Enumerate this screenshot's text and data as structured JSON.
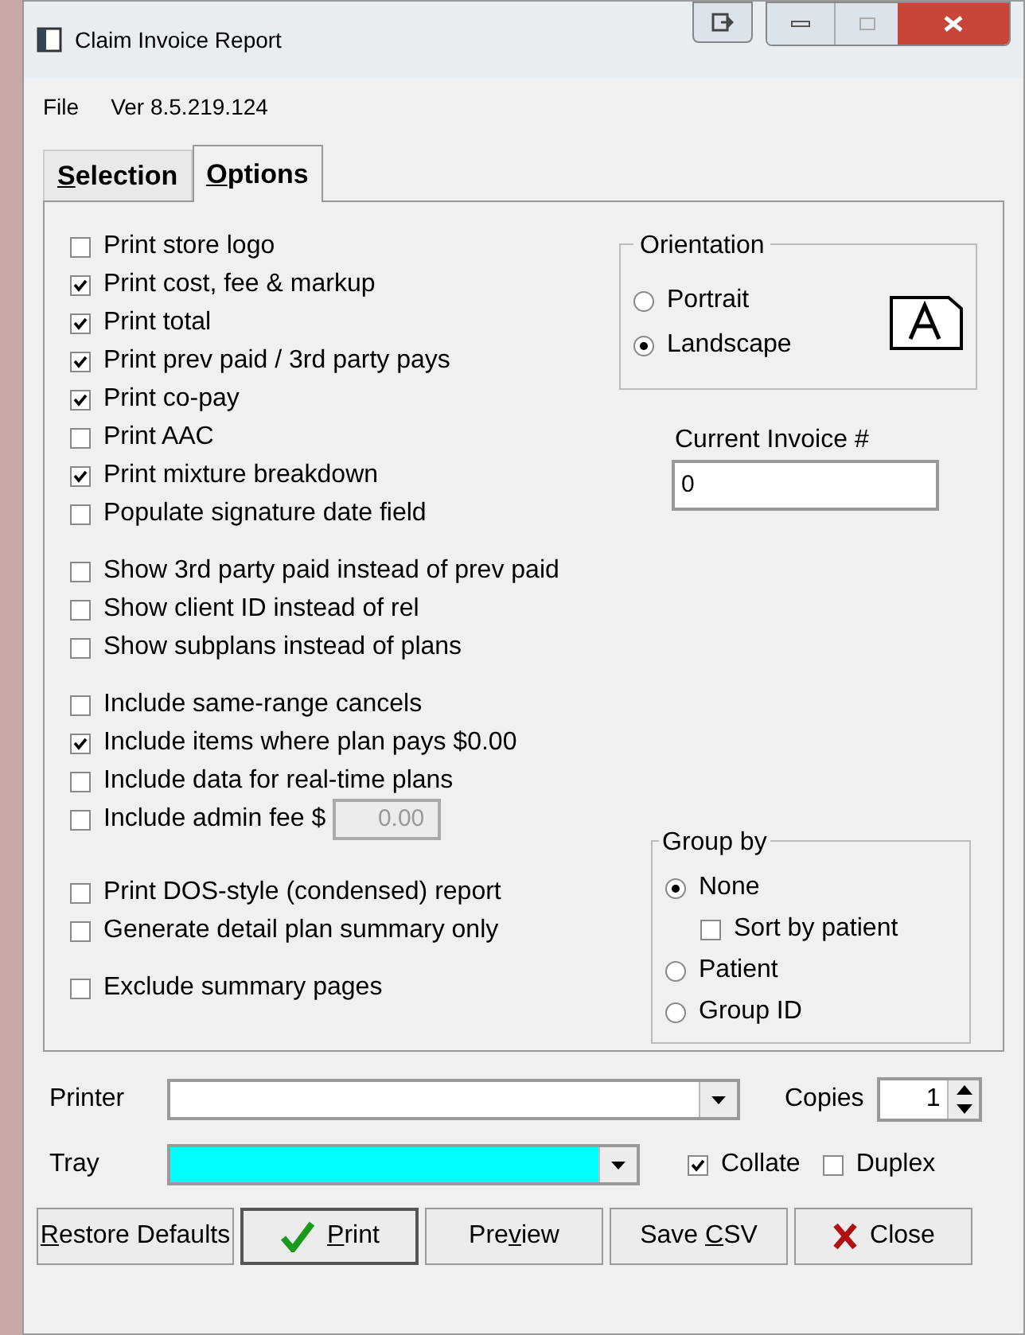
{
  "window": {
    "title": "Claim Invoice Report"
  },
  "menu": [
    {
      "label": "File"
    },
    {
      "label": "Ver 8.5.219.124"
    }
  ],
  "tabs": [
    {
      "key": "S",
      "post": "election",
      "selected": false
    },
    {
      "key": "O",
      "post": "ptions",
      "selected": true
    }
  ],
  "option_groups": [
    [
      {
        "kind": "checkbox",
        "label": "Print store logo",
        "checked": false
      },
      {
        "kind": "checkbox",
        "label": "Print cost, fee & markup",
        "checked": true
      },
      {
        "kind": "checkbox",
        "label": "Print total",
        "checked": true
      },
      {
        "kind": "checkbox",
        "label": "Print prev paid / 3rd party pays",
        "checked": true
      },
      {
        "kind": "checkbox",
        "label": "Print co-pay",
        "checked": true
      },
      {
        "kind": "checkbox",
        "label": "Print AAC",
        "checked": false
      },
      {
        "kind": "checkbox",
        "label": "Print mixture breakdown",
        "checked": true
      },
      {
        "kind": "checkbox",
        "label": "Populate signature date field",
        "checked": false
      }
    ],
    [
      {
        "kind": "checkbox",
        "label": "Show 3rd party paid instead of prev paid",
        "checked": false
      },
      {
        "kind": "checkbox",
        "label": "Show client ID instead of rel",
        "checked": false
      },
      {
        "kind": "checkbox",
        "label": "Show subplans instead of plans",
        "checked": false
      }
    ],
    [
      {
        "kind": "checkbox",
        "label": "Include same-range cancels",
        "checked": false
      },
      {
        "kind": "checkbox",
        "label": "Include items where plan pays $0.00",
        "checked": true
      },
      {
        "kind": "checkbox",
        "label": "Include data for real-time plans",
        "checked": false
      },
      {
        "kind": "amount",
        "label": "Include admin fee $",
        "checked": false,
        "value": "0.00",
        "disabled": true
      }
    ],
    [
      {
        "kind": "checkbox",
        "label": "Print DOS-style (condensed) report",
        "checked": false
      },
      {
        "kind": "checkbox",
        "label": "Generate detail plan summary only",
        "checked": false
      }
    ],
    [
      {
        "kind": "checkbox",
        "label": "Exclude summary pages",
        "checked": false
      }
    ]
  ],
  "orientation": {
    "title": "Orientation",
    "options": [
      {
        "label": "Portrait",
        "selected": false
      },
      {
        "label": "Landscape",
        "selected": true
      }
    ]
  },
  "current_invoice": {
    "label": "Current Invoice #",
    "value": "0"
  },
  "group_by": {
    "title": "Group by",
    "options": [
      {
        "kind": "radio",
        "label": "None",
        "selected": true
      },
      {
        "kind": "checkbox",
        "label": "Sort by patient",
        "checked": false
      },
      {
        "kind": "radio",
        "label": "Patient",
        "selected": false
      },
      {
        "kind": "radio",
        "label": "Group ID",
        "selected": false
      }
    ]
  },
  "printer": {
    "label": "Printer"
  },
  "copies": {
    "label": "Copies",
    "value": "1"
  },
  "tray": {
    "label": "Tray"
  },
  "collate": {
    "label": "Collate",
    "checked": true
  },
  "duplex": {
    "label": "Duplex",
    "checked": false
  },
  "buttons": [
    {
      "kind": "plain",
      "key": "R",
      "post": "estore Defaults"
    },
    {
      "kind": "print",
      "key": "P",
      "post": "rint"
    },
    {
      "kind": "plain",
      "pre": "Pre",
      "key": "v",
      "post": "iew"
    },
    {
      "kind": "plain",
      "pre": "Save ",
      "key": "C",
      "post": "SV"
    },
    {
      "kind": "close",
      "pre": "Close"
    }
  ]
}
